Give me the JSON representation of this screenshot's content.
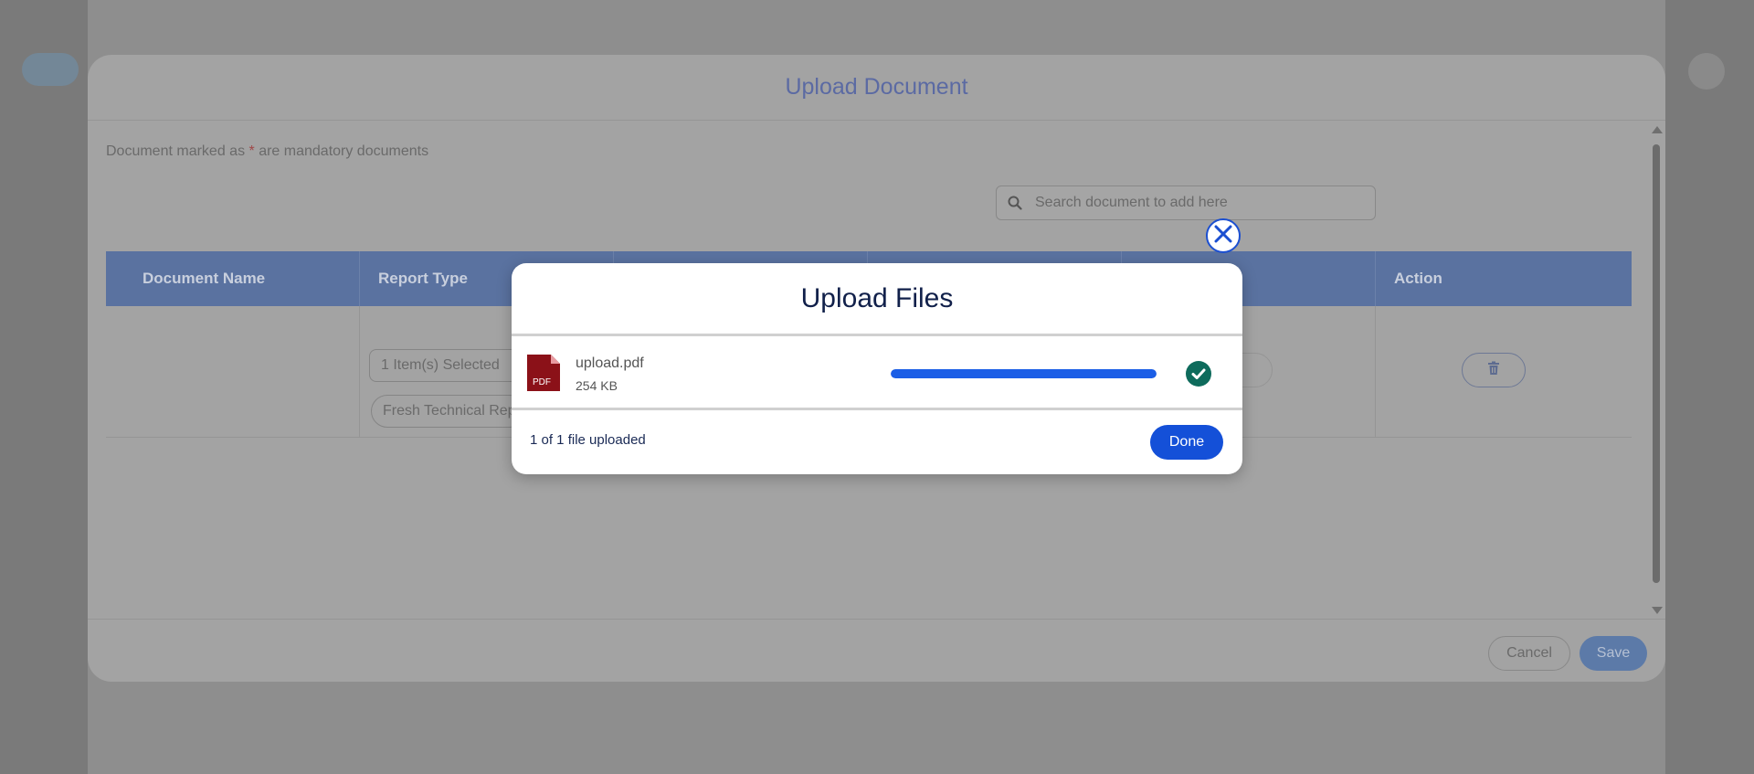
{
  "doc_modal": {
    "title": "Upload Document",
    "note_prefix": "Document marked as ",
    "note_asterisk": "*",
    "note_suffix": " are mandatory documents",
    "search_placeholder": "Search document to add here",
    "columns": [
      "Document Name",
      "Report Type",
      "",
      "",
      "",
      "Action"
    ],
    "row": {
      "report_select": "1 Item(s) Selected",
      "report_type_tag": "Fresh Technical Report"
    },
    "cancel_label": "Cancel",
    "save_label": "Save"
  },
  "upload_modal": {
    "title": "Upload Files",
    "file": {
      "name": "upload.pdf",
      "size": "254 KB",
      "icon_text": "PDF",
      "progress_fraction": 1.0
    },
    "status": "1 of 1 file uploaded",
    "done_label": "Done"
  },
  "colors": {
    "primary": "#1450d8",
    "success": "#0e6b5c",
    "pdf": "#8b1118",
    "title": "#11204a"
  },
  "icons": [
    "search-icon",
    "trash-icon",
    "close-icon",
    "pdf-file-icon",
    "check-circle-icon"
  ]
}
